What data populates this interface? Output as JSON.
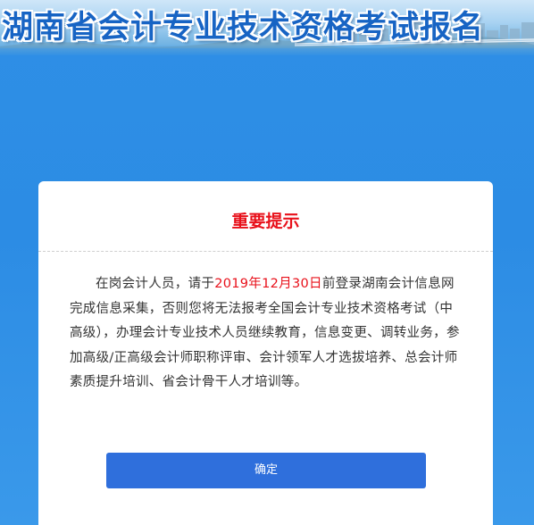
{
  "banner": {
    "title": "湖南省会计专业技术资格考试报名"
  },
  "dialog": {
    "title": "重要提示",
    "notice": {
      "prefix": "在岗会计人员，请于",
      "date": "2019年12月30日",
      "suffix": "前登录湖南会计信息网完成信息采集，否则您将无法报考全国会计专业技术资格考试（中高级），办理会计专业技术人员继续教育，信息变更、调转业务，参加高级/正高级会计师职称评审、会计领军人才选拔培养、总会计师素质提升培训、省会计骨干人才培训等。"
    },
    "confirm_label": "确定"
  },
  "colors": {
    "background": "#2e8fe6",
    "title_red": "#e8101a",
    "button_blue": "#2f6fdc",
    "banner_text": "#1764c4"
  }
}
